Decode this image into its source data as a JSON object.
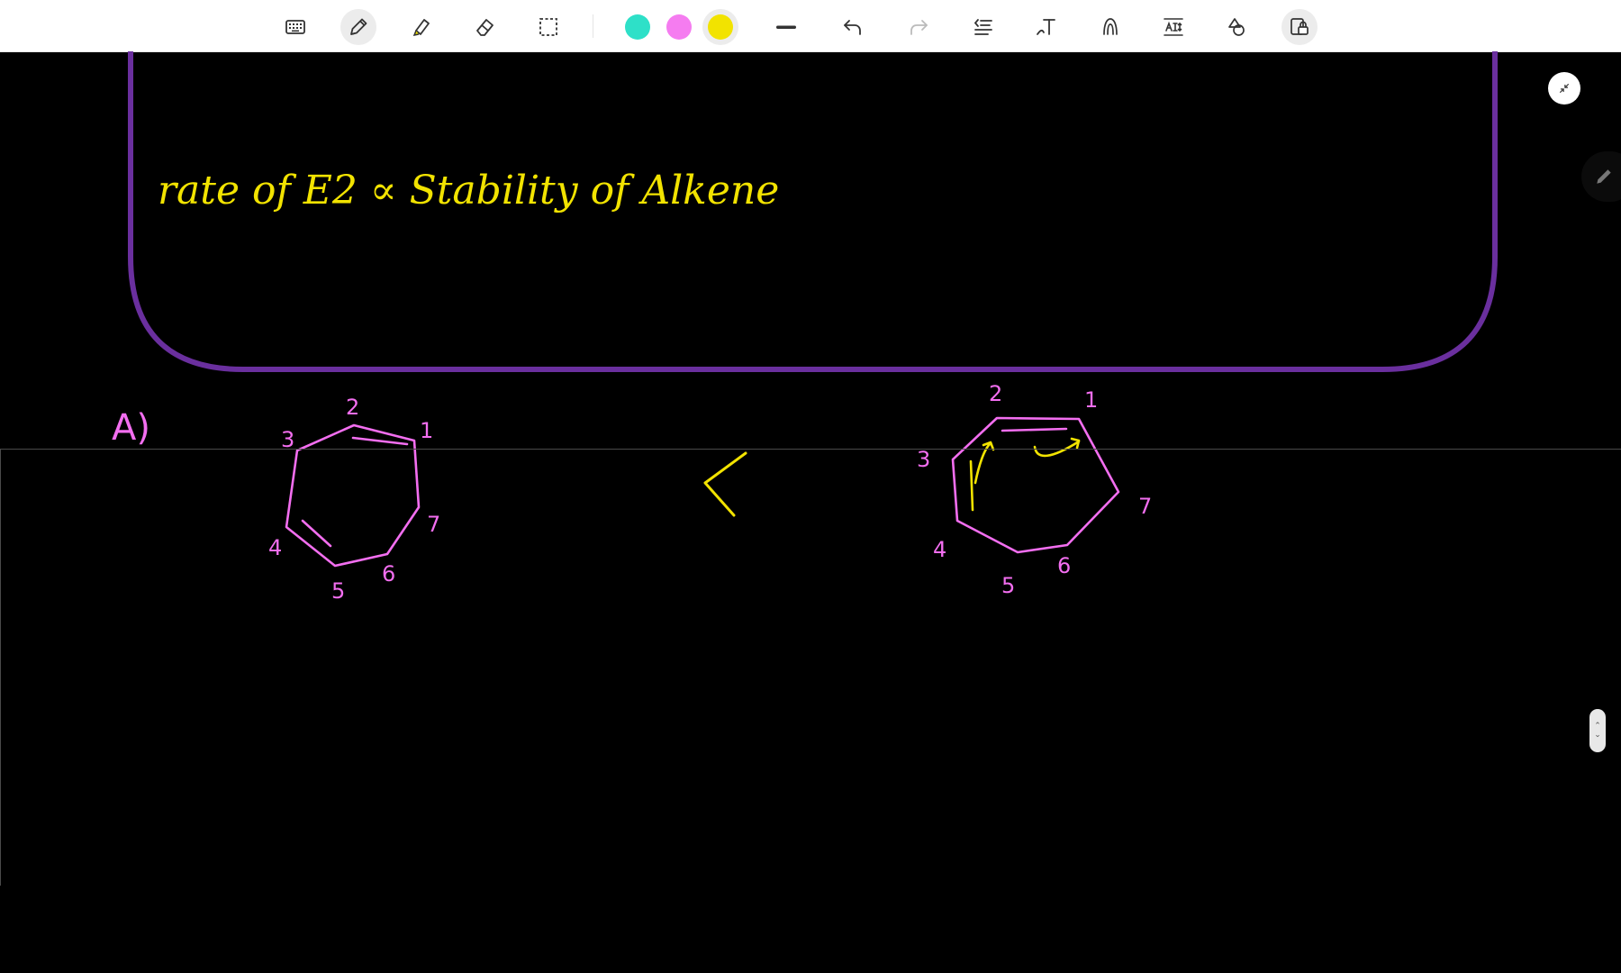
{
  "toolbar": {
    "tools": [
      {
        "name": "keyboard-icon",
        "active": false
      },
      {
        "name": "pen-icon",
        "active": true
      },
      {
        "name": "highlighter-icon",
        "active": false
      },
      {
        "name": "eraser-icon",
        "active": false
      },
      {
        "name": "lasso-select-icon",
        "active": false
      }
    ],
    "colors": [
      {
        "name": "teal",
        "hex": "#2ee0c8",
        "selected": false
      },
      {
        "name": "pink",
        "hex": "#f57cf0",
        "selected": false
      },
      {
        "name": "yellow",
        "hex": "#f2e300",
        "selected": true
      }
    ],
    "stroke": "thick-line-icon",
    "actions": [
      "undo-icon",
      "redo-icon",
      "insert-space-icon",
      "text-tool-icon",
      "shape-recognition-icon",
      "text-size-icon",
      "shapes-icon",
      "lock-page-icon"
    ]
  },
  "board": {
    "frame_color": "#6a2f9e",
    "formula": {
      "text": "rate of E2  ∝  Stability of Alkene",
      "color": "#f2e300"
    },
    "problem_label": "A)",
    "comparison_symbol": "<",
    "ink_pink": "#f36ef0",
    "left_ring_numbers": [
      "1",
      "2",
      "3",
      "4",
      "5",
      "6",
      "7"
    ],
    "right_ring_numbers": [
      "1",
      "2",
      "3",
      "4",
      "5",
      "6",
      "7"
    ]
  }
}
